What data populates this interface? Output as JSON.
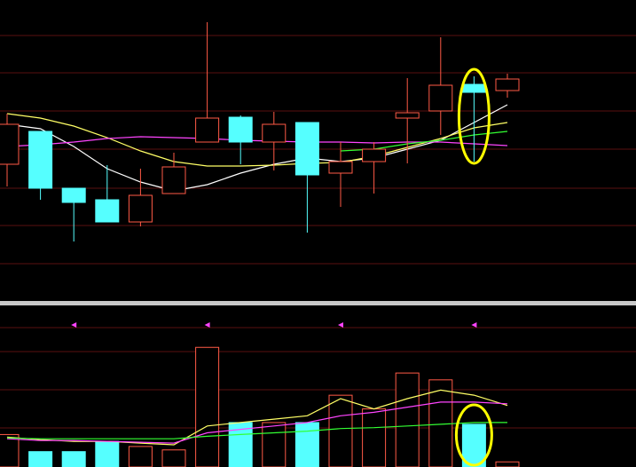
{
  "chart_data": [
    {
      "type": "candlestick",
      "panel": "price",
      "grid": true,
      "ylim": [
        0,
        340
      ],
      "candles": [
        {
          "x": 0,
          "open": 140,
          "close": 185,
          "high": 210,
          "low": 128,
          "color": "#ff5a46",
          "filled": false
        },
        {
          "x": 1,
          "open": 148,
          "close": 212,
          "high": 148,
          "low": 225,
          "color": "#55ffff",
          "filled": true
        },
        {
          "x": 2,
          "open": 212,
          "close": 228,
          "high": 212,
          "low": 272,
          "color": "#55ffff",
          "filled": true
        },
        {
          "x": 3,
          "open": 225,
          "close": 250,
          "high": 186,
          "low": 250,
          "color": "#55ffff",
          "filled": true
        },
        {
          "x": 4,
          "open": 220,
          "close": 250,
          "high": 190,
          "low": 255,
          "color": "#ff5a46",
          "filled": false
        },
        {
          "x": 5,
          "open": 188,
          "close": 218,
          "high": 172,
          "low": 218,
          "color": "#ff5a46",
          "filled": false
        },
        {
          "x": 6,
          "open": 133,
          "close": 160,
          "high": 25,
          "low": 160,
          "color": "#ff5a46",
          "filled": false
        },
        {
          "x": 7,
          "open": 132,
          "close": 160,
          "high": 130,
          "low": 185,
          "color": "#55ffff",
          "filled": true
        },
        {
          "x": 8,
          "open": 140,
          "close": 160,
          "high": 126,
          "low": 192,
          "color": "#ff5a46",
          "filled": false
        },
        {
          "x": 9,
          "open": 138,
          "close": 197,
          "high": 138,
          "low": 262,
          "color": "#55ffff",
          "filled": true
        },
        {
          "x": 10,
          "open": 182,
          "close": 195,
          "high": 160,
          "low": 233,
          "color": "#ff5a46",
          "filled": false
        },
        {
          "x": 11,
          "open": 168,
          "close": 182,
          "high": 160,
          "low": 218,
          "color": "#ff5a46",
          "filled": false
        },
        {
          "x": 12,
          "open": 127,
          "close": 133,
          "high": 88,
          "low": 184,
          "color": "#ff5a46",
          "filled": false
        },
        {
          "x": 13,
          "open": 96,
          "close": 125,
          "high": 42,
          "low": 152,
          "color": "#ff5a46",
          "filled": false
        },
        {
          "x": 14,
          "open": 95,
          "close": 104,
          "high": 86,
          "low": 182,
          "color": "#55ffff",
          "filled": true
        },
        {
          "x": 15,
          "open": 89,
          "close": 102,
          "high": 83,
          "low": 110,
          "color": "#ff5a46",
          "filled": false
        }
      ],
      "series": [
        {
          "color": "#ffffff",
          "values": [
            140,
            145,
            165,
            190,
            205,
            215,
            208,
            195,
            185,
            178,
            182,
            178,
            168,
            158,
            138,
            118
          ]
        },
        {
          "color": "#ffff66",
          "values": [
            128,
            133,
            142,
            155,
            170,
            182,
            187,
            187,
            186,
            184,
            183,
            176,
            166,
            156,
            144,
            138
          ]
        },
        {
          "color": "#ff44ff",
          "values": [
            165,
            163,
            160,
            156,
            154,
            155,
            156,
            158,
            159,
            160,
            160,
            161,
            160,
            160,
            162,
            164
          ]
        },
        {
          "color": "#33ff33",
          "values": [
            null,
            null,
            null,
            null,
            null,
            null,
            null,
            null,
            null,
            null,
            170,
            168,
            162,
            158,
            152,
            148
          ]
        }
      ],
      "annotation": {
        "type": "ellipse",
        "color": "#ffff00",
        "target_index": 14
      }
    },
    {
      "type": "bar",
      "panel": "volume",
      "grid": true,
      "ylim": [
        0,
        160
      ],
      "values": [
        38,
        18,
        18,
        30,
        24,
        20,
        140,
        52,
        52,
        52,
        84,
        68,
        110,
        102,
        50,
        6
      ],
      "colors": [
        "#ff5a46",
        "#55ffff",
        "#55ffff",
        "#55ffff",
        "#ff5a46",
        "#ff5a46",
        "#ff5a46",
        "#55ffff",
        "#ff5a46",
        "#55ffff",
        "#ff5a46",
        "#ff5a46",
        "#ff5a46",
        "#ff5a46",
        "#55ffff",
        "#ff5a46"
      ],
      "filled": [
        false,
        true,
        true,
        true,
        false,
        false,
        false,
        true,
        false,
        true,
        false,
        false,
        false,
        false,
        true,
        false
      ],
      "series": [
        {
          "color": "#ffff66",
          "values": [
            35,
            32,
            30,
            30,
            28,
            26,
            48,
            52,
            56,
            60,
            80,
            68,
            80,
            90,
            84,
            72
          ]
        },
        {
          "color": "#ff44ff",
          "values": [
            33,
            31,
            31,
            30,
            29,
            28,
            40,
            44,
            48,
            52,
            60,
            64,
            70,
            76,
            76,
            74
          ]
        },
        {
          "color": "#33ff33",
          "values": [
            34,
            33,
            33,
            33,
            33,
            33,
            36,
            38,
            40,
            42,
            45,
            46,
            48,
            50,
            52,
            52
          ]
        }
      ],
      "markers": {
        "color": "#ff44ff",
        "indices": [
          2,
          6,
          10,
          14
        ]
      },
      "annotation": {
        "type": "ellipse",
        "color": "#ffff00",
        "target_index": 14
      }
    }
  ],
  "colors": {
    "background": "#000000",
    "grid": "#5a1010",
    "divider": "#c8c8c8",
    "up": "#ff5a46",
    "down": "#55ffff",
    "highlight": "#ffff00"
  }
}
